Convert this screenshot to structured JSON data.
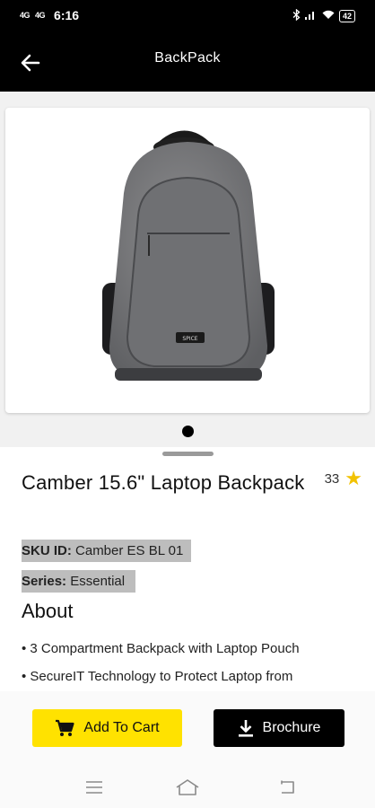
{
  "status_bar": {
    "signal1": "4G",
    "signal2": "4G",
    "time": "6:16",
    "battery": "42"
  },
  "app_bar": {
    "title": "BackPack"
  },
  "product_image": {
    "brand_tag": "SPICE",
    "alt": "Camber 15.6\" Laptop Backpack"
  },
  "product": {
    "name": "Camber 15.6\" Laptop Backpack",
    "rating_count": "33",
    "sku_label": "SKU ID:",
    "sku_value": "Camber ES BL 01",
    "series_label": "Series:",
    "series_value": "Essential",
    "about_heading": "About",
    "features": [
      "• 3 Compartment Backpack with Laptop Pouch",
      "• SecureIT Technology to Protect Laptop from"
    ]
  },
  "actions": {
    "add_to_cart": "Add To Cart",
    "brochure": "Brochure"
  },
  "colors": {
    "accent": "#ffe200",
    "app_bar": "#000000",
    "star": "#f2c200"
  }
}
